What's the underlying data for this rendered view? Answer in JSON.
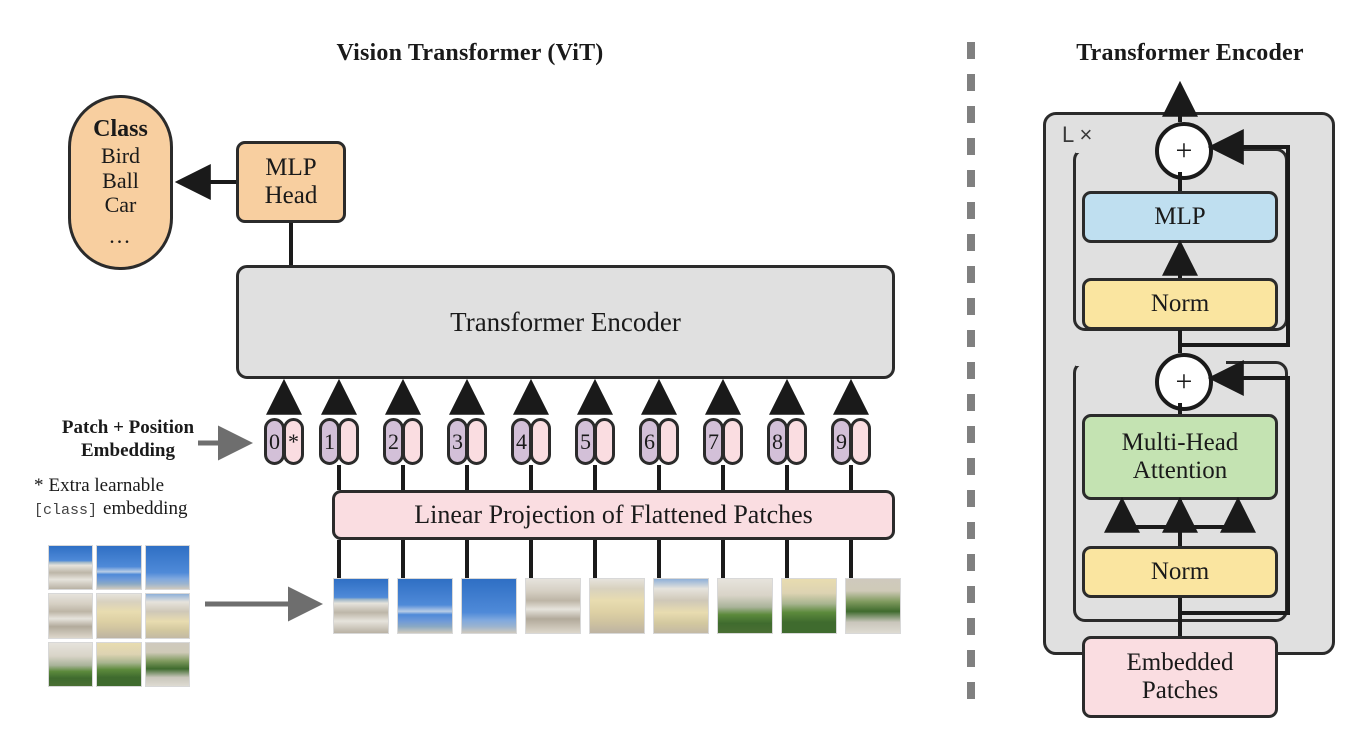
{
  "left_panel": {
    "title": "Vision Transformer (ViT)",
    "class_box": {
      "heading": "Class",
      "items": [
        "Bird",
        "Ball",
        "Car"
      ],
      "ellipsis": "...",
      "color": "#f8cfa0"
    },
    "mlp_head": {
      "line1": "MLP",
      "line2": "Head",
      "color": "#f8cfa0"
    },
    "encoder_box": {
      "label": "Transformer Encoder",
      "color": "#e0e0e0"
    },
    "embedding_caption": {
      "line1": "Patch + Position",
      "line2": "Embedding",
      "note_star": "*",
      "note_line1": "Extra learnable",
      "note_code": "[class]",
      "note_line2": "embedding"
    },
    "tokens": {
      "cls_number": "0",
      "cls_star": "*",
      "numbers": [
        "1",
        "2",
        "3",
        "4",
        "5",
        "6",
        "7",
        "8",
        "9"
      ],
      "number_color": "#d3c0d8",
      "embed_color": "#fadde1"
    },
    "linear_projection": {
      "label": "Linear Projection of Flattened Patches",
      "color": "#fadde1"
    },
    "source_image": {
      "alt": "photo of a baroque palace facade with blue sky and garden",
      "grid_rows": 3,
      "grid_cols": 3,
      "patch_count": 9
    }
  },
  "divider": {
    "style": "dashed-vertical",
    "color": "#808080"
  },
  "right_panel": {
    "title": "Transformer Encoder",
    "repeat_label": "L ×",
    "outer_box_color": "#e0e0e0",
    "blocks": [
      {
        "name": "mlp",
        "label": "MLP",
        "color": "#bfdff0"
      },
      {
        "name": "norm-top",
        "label": "Norm",
        "color": "#fae5a0"
      },
      {
        "name": "multi-head-attention",
        "label": "Multi-Head\nAttention",
        "line1": "Multi-Head",
        "line2": "Attention",
        "color": "#c4e3b2"
      },
      {
        "name": "norm-bottom",
        "label": "Norm",
        "color": "#fae5a0"
      },
      {
        "name": "embedded-patches",
        "line1": "Embedded",
        "line2": "Patches",
        "color": "#fadde1"
      }
    ],
    "adders": {
      "symbol": "+",
      "count": 2
    }
  }
}
